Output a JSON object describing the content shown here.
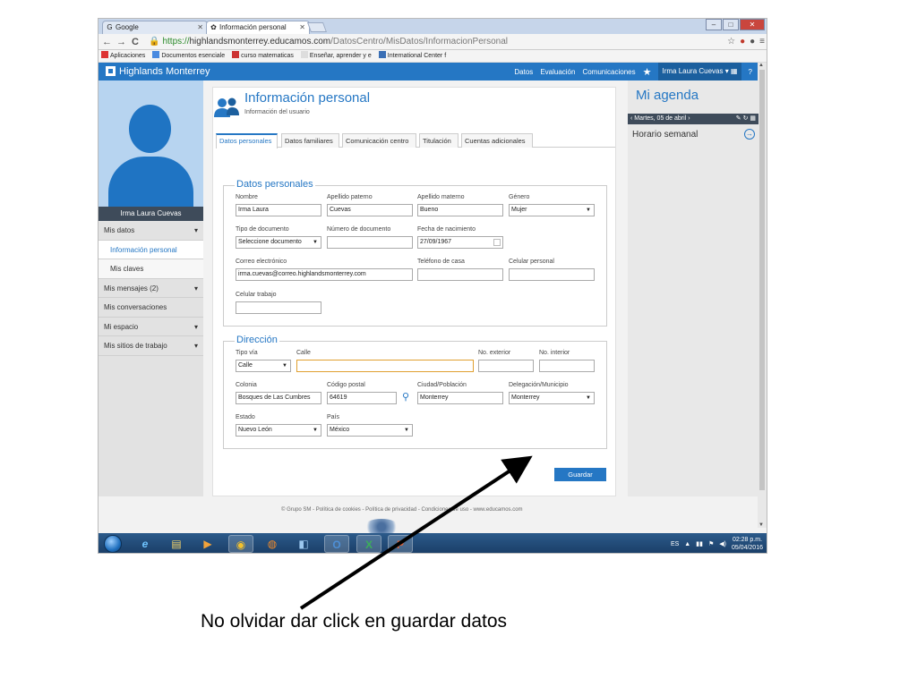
{
  "browser": {
    "tabs": [
      {
        "label": "Google",
        "icon": "G"
      },
      {
        "label": "Información personal",
        "icon": "✿"
      }
    ],
    "url": {
      "scheme": "https://",
      "host": "highlandsmonterrey.educamos.com",
      "path": "/DatosCentro/MisDatos/InformacionPersonal"
    },
    "bookmarks": [
      "Aplicaciones",
      "Documentos esenciale",
      "curso matematicas",
      "Enseñar, aprender y e",
      "International Center f"
    ]
  },
  "site": {
    "brand": "Highlands Monterrey",
    "nav": [
      "Datos",
      "Evaluación",
      "Comunicaciones"
    ],
    "user": "Irma Laura Cuevas ▾",
    "help": "?"
  },
  "sidebar": {
    "name": "Irma Laura Cuevas",
    "items": [
      {
        "label": "Mis datos",
        "chevron": "▾"
      },
      {
        "label": "Información personal"
      },
      {
        "label": "Mis claves"
      },
      {
        "label": "Mis mensajes (2)",
        "chevron": "▾"
      },
      {
        "label": "Mis conversaciones"
      },
      {
        "label": "Mi espacio",
        "chevron": "▾"
      },
      {
        "label": "Mis sitios de trabajo",
        "chevron": "▾"
      }
    ]
  },
  "page": {
    "title": "Información personal",
    "subtitle": "Información del usuario",
    "tabs": [
      "Datos personales",
      "Datos familiares",
      "Comunicación centro",
      "Titulación",
      "Cuentas adicionales"
    ]
  },
  "personal": {
    "legend": "Datos personales",
    "nombre": {
      "label": "Nombre",
      "value": "Irma Laura"
    },
    "apellido_paterno": {
      "label": "Apellido paterno",
      "value": "Cuevas"
    },
    "apellido_materno": {
      "label": "Apellido materno",
      "value": "Bueno"
    },
    "genero": {
      "label": "Género",
      "value": "Mujer"
    },
    "tipo_documento": {
      "label": "Tipo de documento",
      "value": "Seleccione documento"
    },
    "numero_documento": {
      "label": "Número de documento",
      "value": ""
    },
    "fecha_nacimiento": {
      "label": "Fecha de nacimiento",
      "value": "27/09/1967"
    },
    "correo": {
      "label": "Correo electrónico",
      "value": "irma.cuevas@correo.highlandsmonterrey.com"
    },
    "telefono_casa": {
      "label": "Teléfono de casa",
      "value": ""
    },
    "celular_personal": {
      "label": "Celular personal",
      "value": ""
    },
    "celular_trabajo": {
      "label": "Celular trabajo",
      "value": ""
    }
  },
  "direccion": {
    "legend": "Dirección",
    "tipo_via": {
      "label": "Tipo vía",
      "value": "Calle"
    },
    "calle": {
      "label": "Calle",
      "value": ""
    },
    "no_exterior": {
      "label": "No. exterior",
      "value": ""
    },
    "no_interior": {
      "label": "No. interior",
      "value": ""
    },
    "colonia": {
      "label": "Colonia",
      "value": "Bosques de Las Cumbres"
    },
    "codigo_postal": {
      "label": "Código postal",
      "value": "64619"
    },
    "ciudad": {
      "label": "Ciudad/Población",
      "value": "Monterrey"
    },
    "delegacion": {
      "label": "Delegación/Municipio",
      "value": "Monterrey"
    },
    "estado": {
      "label": "Estado",
      "value": "Nuevo León"
    },
    "pais": {
      "label": "País",
      "value": "México"
    }
  },
  "actions": {
    "guardar": "Guardar"
  },
  "agenda": {
    "title": "Mi agenda",
    "date": "‹ Martes, 05 de abril ›",
    "horario": "Horario semanal"
  },
  "footer": "© Grupo SM - Política de cookies - Política de privacidad - Condiciones de uso - www.educamos.com",
  "taskbar": {
    "lang": "ES",
    "time": "02:28 p.m.",
    "date": "05/04/2016"
  },
  "annotation": {
    "caption": "No olvidar dar click en guardar datos"
  },
  "colors": {
    "accent": "#2577c4",
    "sidebar_dark": "#3e4b5a"
  }
}
